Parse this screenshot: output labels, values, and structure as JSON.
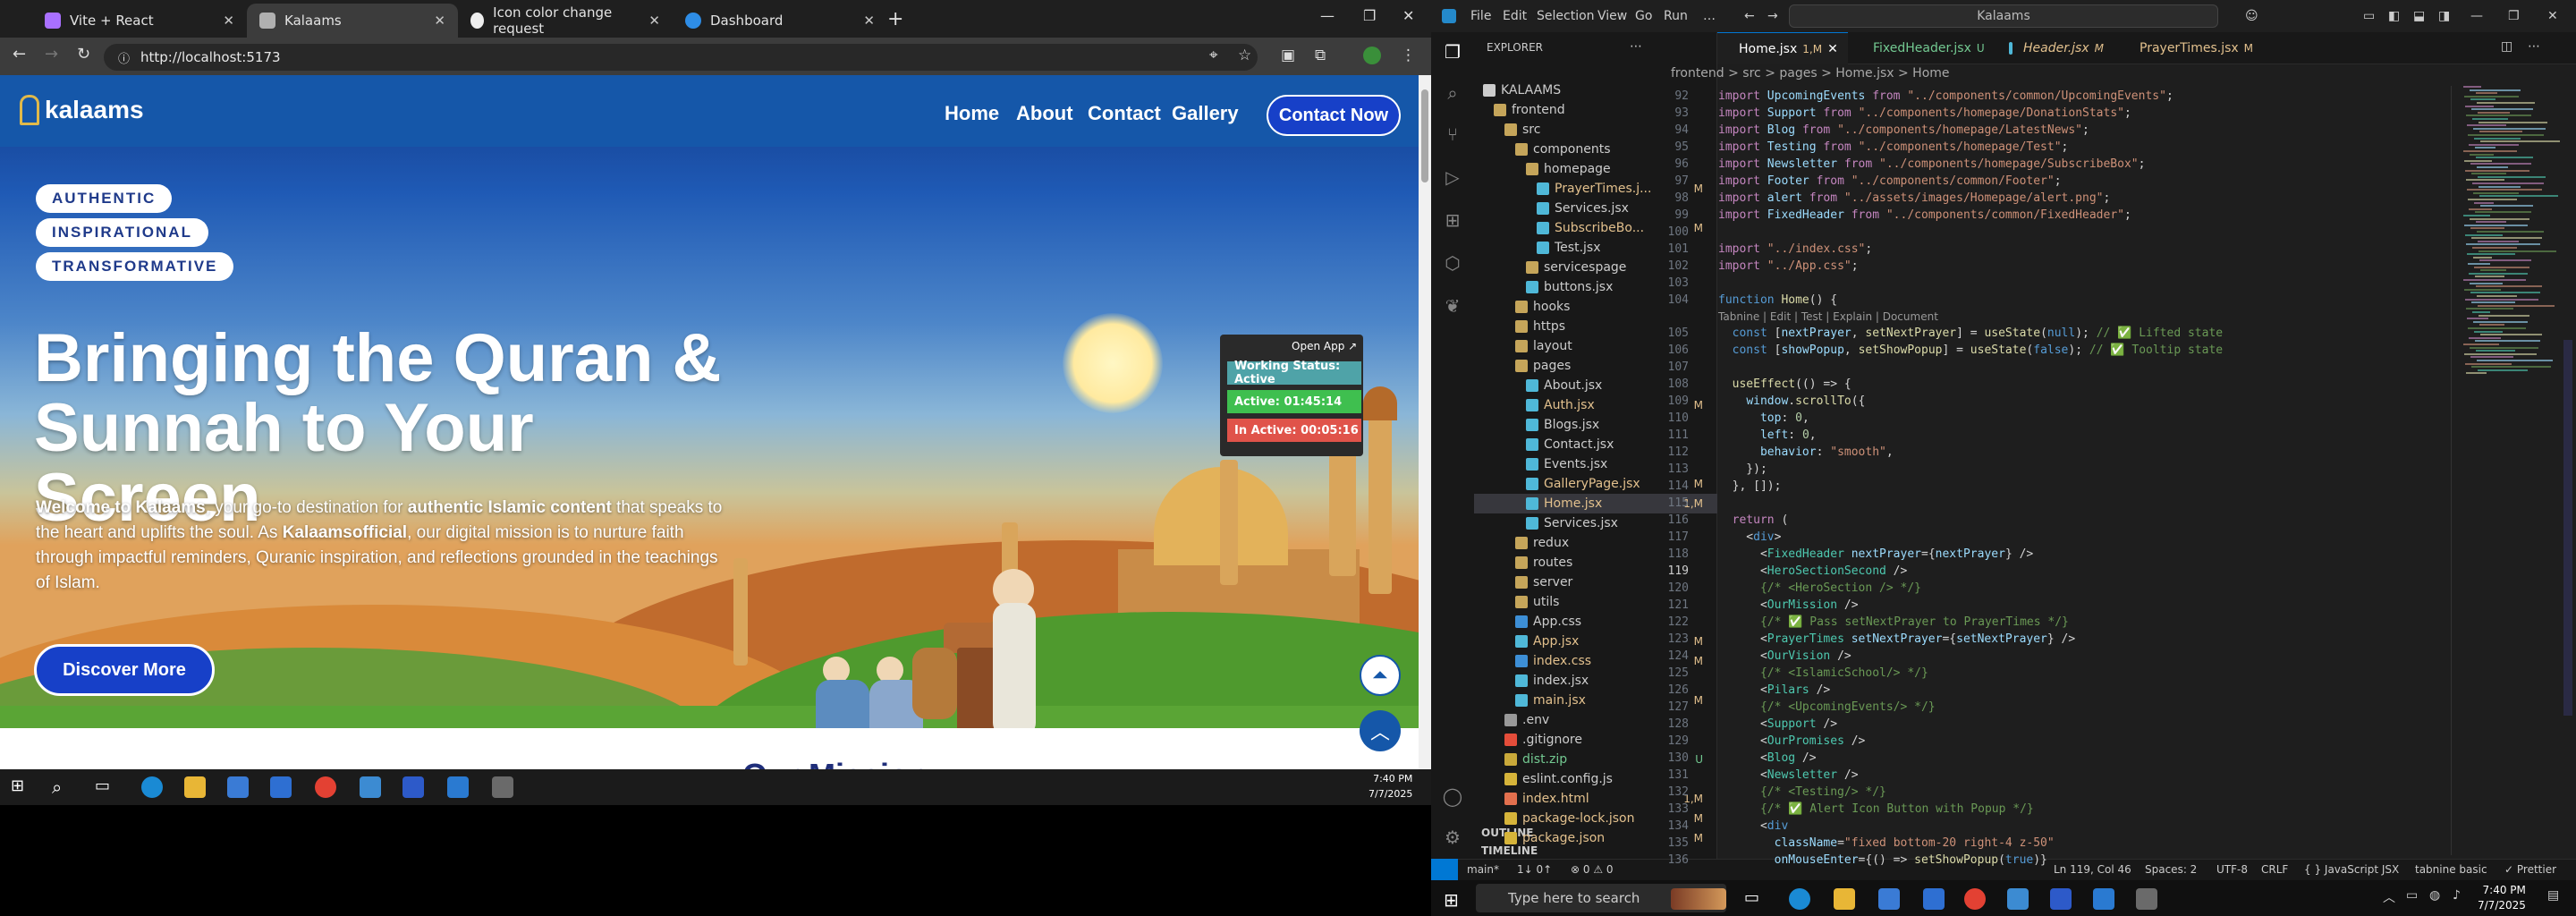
{
  "browser": {
    "tabs": [
      {
        "label": "Vite + React",
        "active": false
      },
      {
        "label": "Kalaams",
        "active": true
      },
      {
        "label": "Icon color change request",
        "active": false
      },
      {
        "label": "Dashboard",
        "active": false
      }
    ],
    "url": "http://localhost:5173"
  },
  "site": {
    "logo_text": "kalaams",
    "nav": [
      "Home",
      "About",
      "Contact",
      "Gallery"
    ],
    "contact_button": "Contact Now",
    "pills": [
      "AUTHENTIC",
      "INSPIRATIONAL",
      "TRANSFORMATIVE"
    ],
    "hero_title": "Bringing the Quran & Sunnah to Your Screen",
    "hero_paragraph_parts": {
      "b1": "Welcome to Kalaams",
      "t1": ", your go-to destination for ",
      "b2": "authentic Islamic content",
      "t2": " that speaks to the heart and uplifts the soul. As ",
      "b3": "Kalaamsofficial",
      "t3": ", our digital mission is to nurture faith through impactful reminders, Quranic inspiration, and reflections grounded in the teachings of Islam."
    },
    "discover_button": "Discover More",
    "status_widget": {
      "open_app": "Open App ↗",
      "working": "Working Status: Active",
      "active": "Active: 01:45:14",
      "inactive": "In Active: 00:05:16"
    },
    "next_section": "Our Mission"
  },
  "browser_taskbar": {
    "time": "7:40 PM",
    "date": "7/7/2025"
  },
  "vscode": {
    "menu": [
      "File",
      "Edit",
      "Selection",
      "View",
      "Go",
      "Run",
      "…"
    ],
    "search": "Kalaams",
    "explorer_title": "EXPLORER",
    "tree": [
      {
        "label": "KALAAMS",
        "depth": 0,
        "type": "root",
        "badge": ""
      },
      {
        "label": "frontend",
        "depth": 1,
        "type": "folder",
        "badge": ""
      },
      {
        "label": "src",
        "depth": 2,
        "type": "folder",
        "badge": ""
      },
      {
        "label": "components",
        "depth": 3,
        "type": "folder",
        "badge": ""
      },
      {
        "label": "homepage",
        "depth": 4,
        "type": "folder",
        "badge": ""
      },
      {
        "label": "PrayerTimes.j...",
        "depth": 5,
        "type": "jsx",
        "badge": "M"
      },
      {
        "label": "Services.jsx",
        "depth": 5,
        "type": "jsx",
        "badge": ""
      },
      {
        "label": "SubscribeBo...",
        "depth": 5,
        "type": "jsx",
        "badge": "M"
      },
      {
        "label": "Test.jsx",
        "depth": 5,
        "type": "jsx",
        "badge": ""
      },
      {
        "label": "servicespage",
        "depth": 4,
        "type": "folder",
        "badge": ""
      },
      {
        "label": "buttons.jsx",
        "depth": 4,
        "type": "jsx",
        "badge": ""
      },
      {
        "label": "hooks",
        "depth": 3,
        "type": "folder",
        "badge": ""
      },
      {
        "label": "https",
        "depth": 3,
        "type": "folder",
        "badge": ""
      },
      {
        "label": "layout",
        "depth": 3,
        "type": "folder",
        "badge": ""
      },
      {
        "label": "pages",
        "depth": 3,
        "type": "folder",
        "badge": ""
      },
      {
        "label": "About.jsx",
        "depth": 4,
        "type": "jsx",
        "badge": ""
      },
      {
        "label": "Auth.jsx",
        "depth": 4,
        "type": "jsx",
        "badge": "M"
      },
      {
        "label": "Blogs.jsx",
        "depth": 4,
        "type": "jsx",
        "badge": ""
      },
      {
        "label": "Contact.jsx",
        "depth": 4,
        "type": "jsx",
        "badge": ""
      },
      {
        "label": "Events.jsx",
        "depth": 4,
        "type": "jsx",
        "badge": ""
      },
      {
        "label": "GalleryPage.jsx",
        "depth": 4,
        "type": "jsx",
        "badge": "M"
      },
      {
        "label": "Home.jsx",
        "depth": 4,
        "type": "jsx",
        "badge": "1,M"
      },
      {
        "label": "Services.jsx",
        "depth": 4,
        "type": "jsx",
        "badge": ""
      },
      {
        "label": "redux",
        "depth": 3,
        "type": "folder",
        "badge": ""
      },
      {
        "label": "routes",
        "depth": 3,
        "type": "folder",
        "badge": ""
      },
      {
        "label": "server",
        "depth": 3,
        "type": "folder",
        "badge": ""
      },
      {
        "label": "utils",
        "depth": 3,
        "type": "folder",
        "badge": ""
      },
      {
        "label": "App.css",
        "depth": 3,
        "type": "css",
        "badge": ""
      },
      {
        "label": "App.jsx",
        "depth": 3,
        "type": "jsx",
        "badge": "M"
      },
      {
        "label": "index.css",
        "depth": 3,
        "type": "css",
        "badge": "M"
      },
      {
        "label": "index.jsx",
        "depth": 3,
        "type": "jsx",
        "badge": ""
      },
      {
        "label": "main.jsx",
        "depth": 3,
        "type": "jsx",
        "badge": "M"
      },
      {
        "label": ".env",
        "depth": 2,
        "type": "file",
        "badge": ""
      },
      {
        "label": ".gitignore",
        "depth": 2,
        "type": "git",
        "badge": ""
      },
      {
        "label": "dist.zip",
        "depth": 2,
        "type": "zip",
        "badge": "U"
      },
      {
        "label": "eslint.config.js",
        "depth": 2,
        "type": "js",
        "badge": ""
      },
      {
        "label": "index.html",
        "depth": 2,
        "type": "html",
        "badge": "1,M"
      },
      {
        "label": "package-lock.json",
        "depth": 2,
        "type": "json",
        "badge": "M"
      },
      {
        "label": "package.json",
        "depth": 2,
        "type": "json",
        "badge": "M"
      }
    ],
    "outline": "OUTLINE",
    "timeline": "TIMELINE",
    "editor_tabs": [
      {
        "label": "Home.jsx",
        "badge": "1,M",
        "active": true
      },
      {
        "label": "FixedHeader.jsx",
        "badge": "U",
        "active": false
      },
      {
        "label": "Header.jsx",
        "badge": "M",
        "active": false
      },
      {
        "label": "PrayerTimes.jsx",
        "badge": "M",
        "active": false
      }
    ],
    "breadcrumb": "frontend > src > pages > Home.jsx > Home",
    "codelens": "Tabnine | Edit | Test | Explain | Document",
    "first_line": 92,
    "current_line": 119,
    "status": {
      "branch": "main*",
      "sync": "1↓ 0↑",
      "problems": "⊗ 0 ⚠ 0",
      "position": "Ln 119, Col 46",
      "spaces": "Spaces: 2",
      "encoding": "UTF-8",
      "eol": "CRLF",
      "language": "{ } JavaScript JSX",
      "tabnine": "tabnine basic",
      "prettier": "✓ Prettier"
    }
  },
  "windows_taskbar": {
    "search": "Type here to search",
    "time": "7:40 PM",
    "date": "7/7/2025"
  }
}
